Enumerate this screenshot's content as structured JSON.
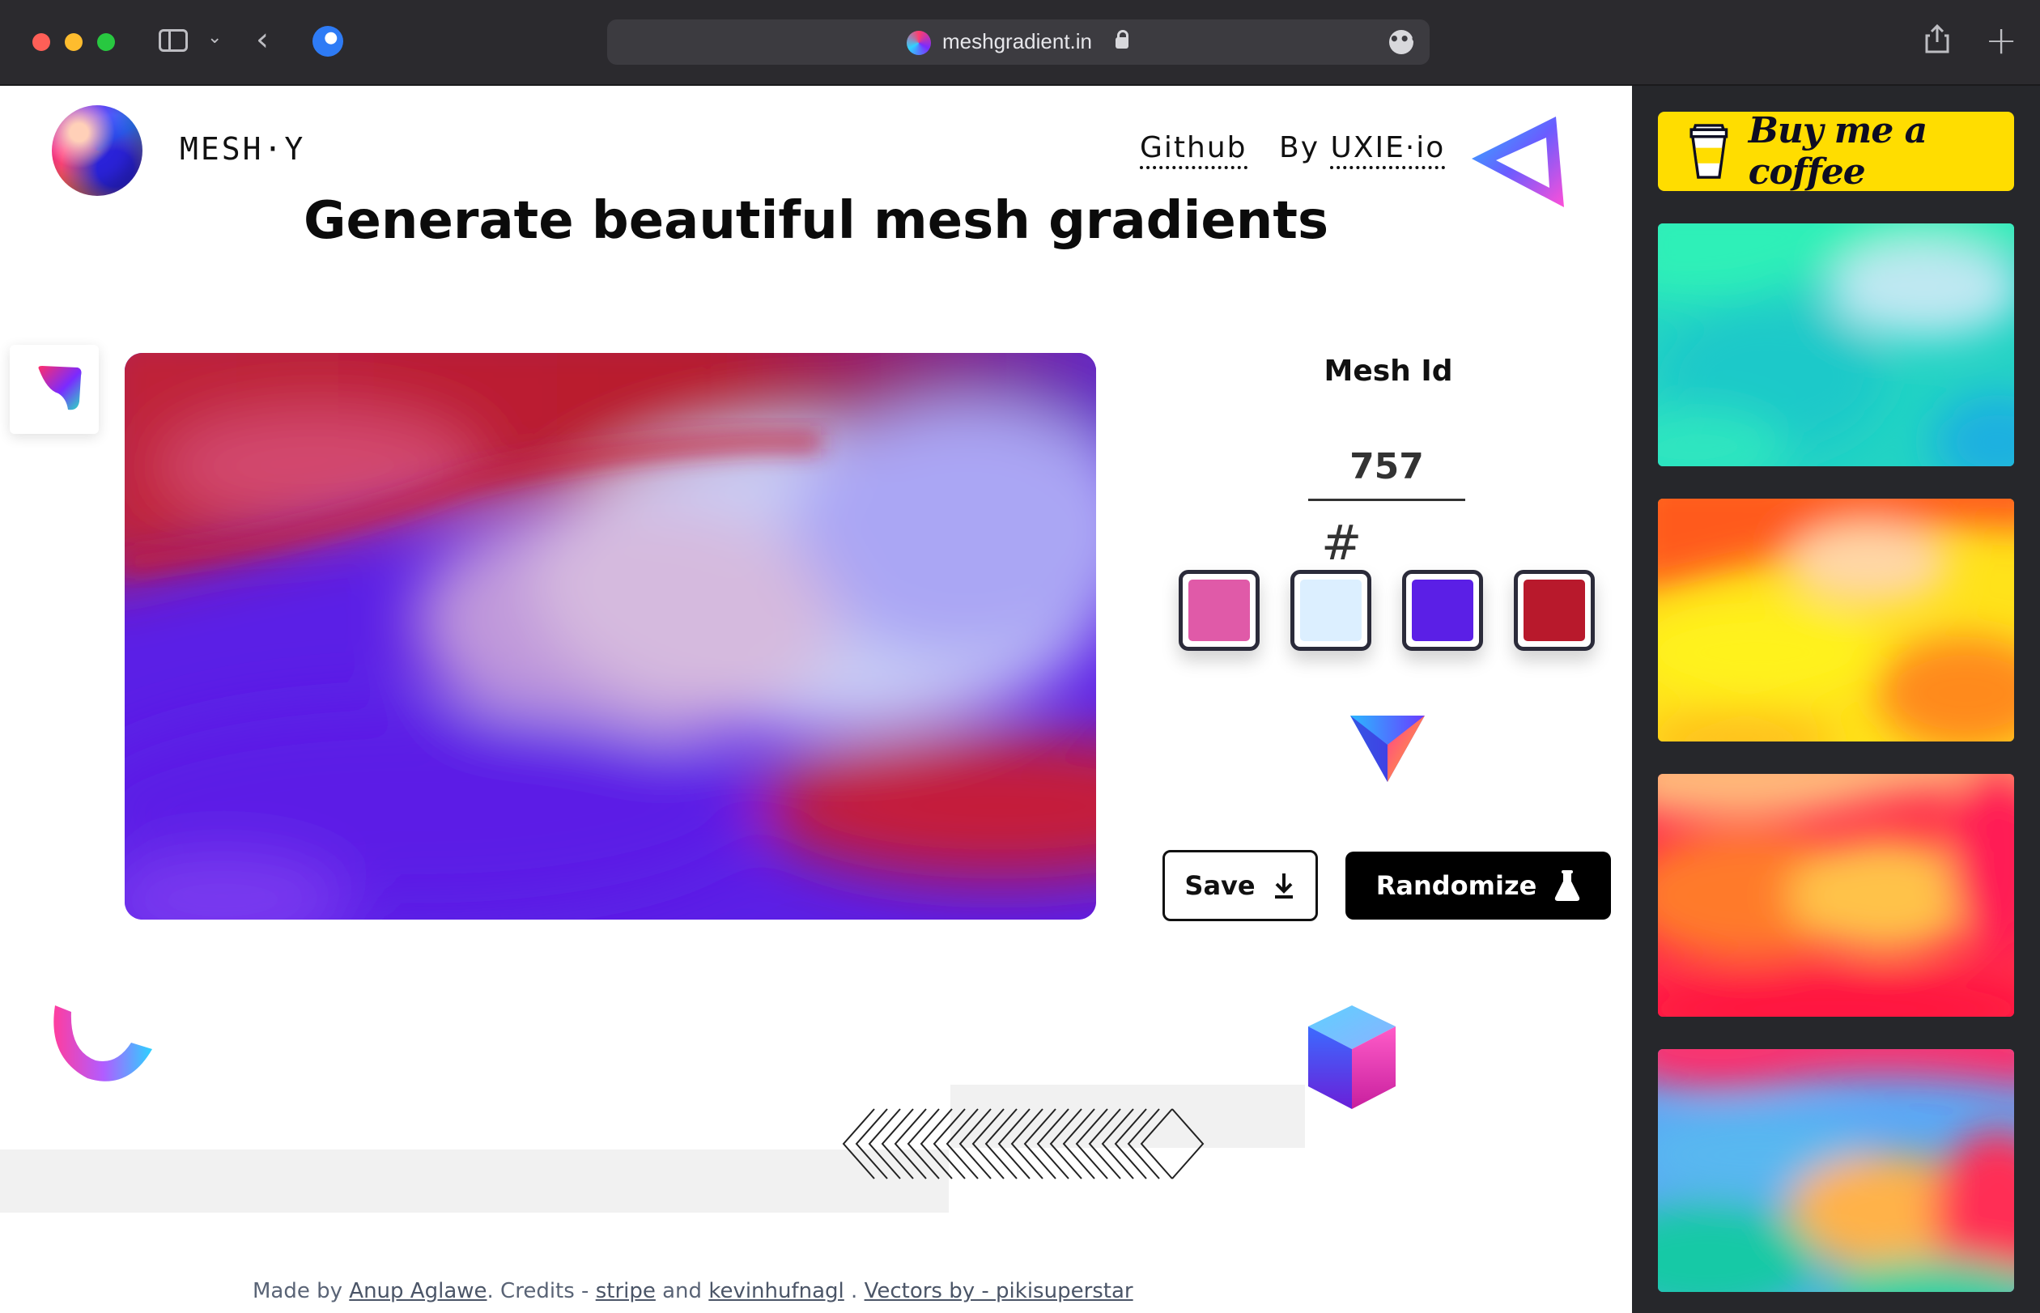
{
  "browser": {
    "url": "meshgradient.in",
    "back_icon": "chevron-left-icon",
    "more_icon": "ellipsis-icon"
  },
  "header": {
    "brand": "MESH·Y",
    "nav_github": "Github",
    "nav_by_prefix": "By",
    "nav_by_link": "UXIE·io"
  },
  "main": {
    "headline": "Generate beautiful mesh gradients",
    "mesh_id_label": "Mesh Id",
    "mesh_id_value": "757",
    "hash_symbol": "#",
    "colors": [
      "#e05aa8",
      "#dcefff",
      "#5b1fe6",
      "#b8192c"
    ],
    "save_label": "Save",
    "randomize_label": "Randomize"
  },
  "footer": {
    "made_by": "Made by",
    "author": "Anup Aglawe",
    "credits": ". Credits -",
    "stripe": "stripe",
    "and": "and",
    "kevin": "kevinhufnagl",
    "sep": ".",
    "vectors": "Vectors by - pikisuperstar"
  },
  "sidebar": {
    "buy_coffee": "Buy me a coffee",
    "thumbnails": [
      "teal-mesh",
      "orange-yellow-mesh",
      "red-orange-mesh",
      "pink-blue-mesh"
    ]
  },
  "colors": {
    "chrome_bg": "#2b2a2e",
    "panel_bg": "#26272b",
    "coffee_yellow": "#ffdd00"
  }
}
